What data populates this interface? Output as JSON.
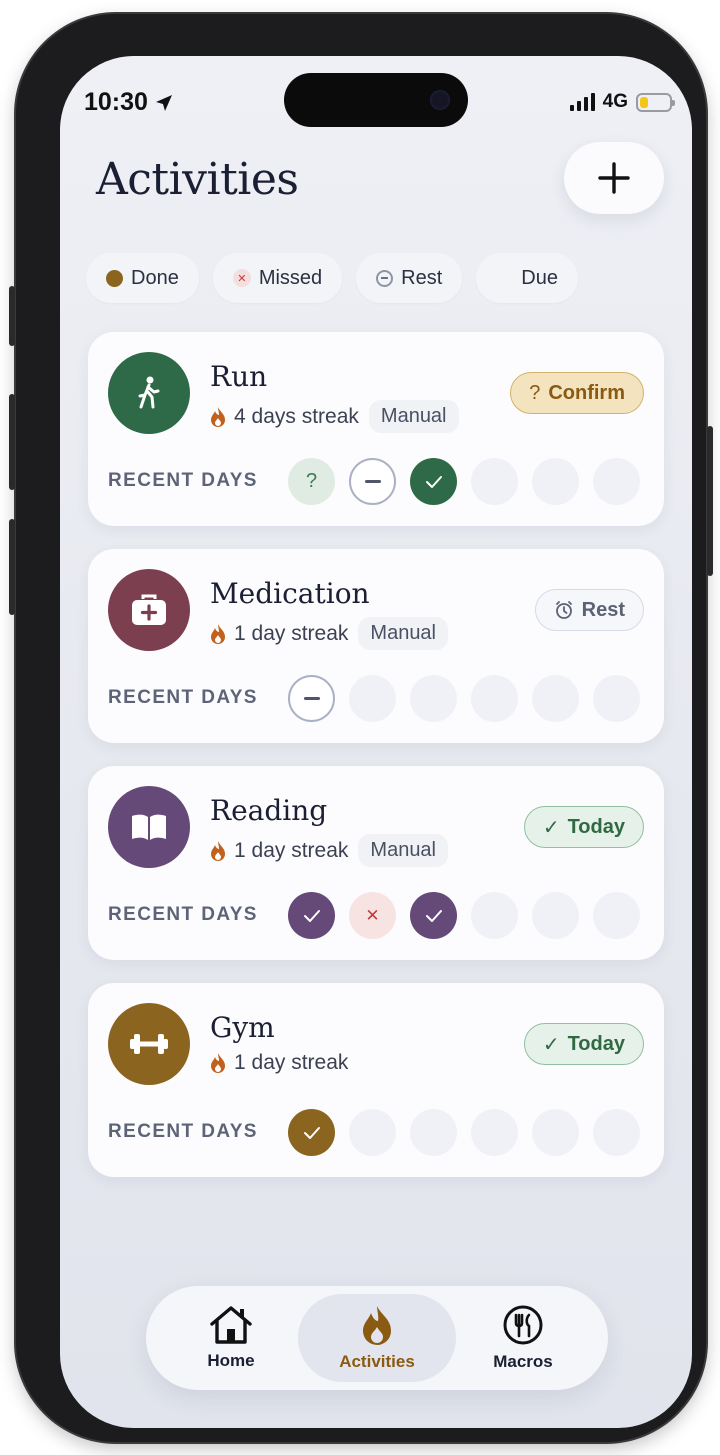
{
  "status_bar": {
    "time": "10:30",
    "network": "4G"
  },
  "header": {
    "title": "Activities"
  },
  "legend": [
    {
      "label": "Done",
      "icon": "done-dot"
    },
    {
      "label": "Missed",
      "icon": "missed-x"
    },
    {
      "label": "Rest",
      "icon": "rest-dash"
    },
    {
      "label": "Due",
      "icon": "due-empty"
    }
  ],
  "recent_label": "RECENT DAYS",
  "activities": [
    {
      "name": "Run",
      "streak": "4 days streak",
      "tag": "Manual",
      "status": "Confirm",
      "status_icon": "?",
      "color": "#2e6a47",
      "icon": "walking-icon",
      "days": [
        "?",
        "rest",
        "done",
        "empty",
        "empty",
        "empty"
      ]
    },
    {
      "name": "Medication",
      "streak": "1 day streak",
      "tag": "Manual",
      "status": "Rest",
      "status_icon": "alarm",
      "color": "#7c3f4f",
      "icon": "medkit-icon",
      "days": [
        "rest",
        "empty",
        "empty",
        "empty",
        "empty",
        "empty"
      ]
    },
    {
      "name": "Reading",
      "streak": "1 day streak",
      "tag": "Manual",
      "status": "Today",
      "status_icon": "✓",
      "color": "#654978",
      "icon": "book-icon",
      "days": [
        "done",
        "missed",
        "done",
        "empty",
        "empty",
        "empty"
      ]
    },
    {
      "name": "Gym",
      "streak": "1 day streak",
      "tag": "",
      "status": "Today",
      "status_icon": "✓",
      "color": "#8b6420",
      "icon": "dumbbell-icon",
      "days": [
        "done",
        "empty",
        "empty",
        "empty",
        "empty",
        "empty"
      ]
    }
  ],
  "tabbar": {
    "home": "Home",
    "activities": "Activities",
    "macros": "Macros",
    "active_color": "#8a5a12"
  }
}
